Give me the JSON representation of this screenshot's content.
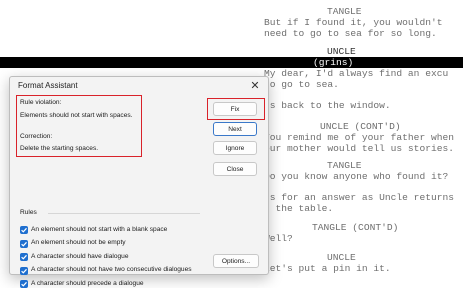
{
  "script": {
    "lines_top": [
      {
        "text": "TANGLE",
        "cls": "c1"
      },
      {
        "text": "But if I found it, you wouldn't",
        "cls": "act"
      },
      {
        "text": "need to go to sea for so long.",
        "cls": "act"
      }
    ],
    "uncle_heading": "UNCLE",
    "selected_line": "(grins)",
    "lines_rest": [
      {
        "text": "My dear, I'd always find an excu",
        "cls": "act"
      },
      {
        "text": "to go to sea.",
        "cls": "act"
      },
      {
        "text": "ns back to the window.",
        "cls": "act"
      },
      {
        "text": "UNCLE (CONT'D)",
        "cls": "c2"
      },
      {
        "text": "You remind me of your father when",
        "cls": "act"
      },
      {
        "text": "our mother would tell us stories.",
        "cls": "act"
      },
      {
        "text": "TANGLE",
        "cls": "c1"
      },
      {
        "text": "Do you know anyone who found it?",
        "cls": "act"
      },
      {
        "text": "ts for an answer as Uncle returns",
        "cls": "act"
      },
      {
        "text": "s the table.",
        "cls": "act"
      },
      {
        "text": "TANGLE (CONT'D)",
        "cls": "c3"
      },
      {
        "text": "Well?",
        "cls": "act"
      },
      {
        "text": "UNCLE",
        "cls": "c1"
      },
      {
        "text": "Let's put a pin in it.",
        "cls": "act"
      }
    ]
  },
  "dialog": {
    "title": "Format Assistant",
    "close_glyph": "✕",
    "rule_violation_label": "Rule violation:",
    "rule_violation_text": "Elements should not start with spaces.",
    "correction_label": "Correction:",
    "correction_text": "Delete the starting spaces.",
    "buttons": {
      "fix": "Fix",
      "next": "Next",
      "ignore": "Ignore",
      "close": "Close",
      "options": "Options..."
    },
    "rules_label": "Rules",
    "rules": [
      {
        "label": "An element should not start with a blank space",
        "checked": true
      },
      {
        "label": "An element should not be empty",
        "checked": true
      },
      {
        "label": "A character should have dialogue",
        "checked": true
      },
      {
        "label": "A character should not have two consecutive dialogues",
        "checked": true
      },
      {
        "label": "A character should precede a dialogue",
        "checked": true
      }
    ],
    "accent_color": "#1f6fcf",
    "highlight_color": "#d9222a"
  }
}
